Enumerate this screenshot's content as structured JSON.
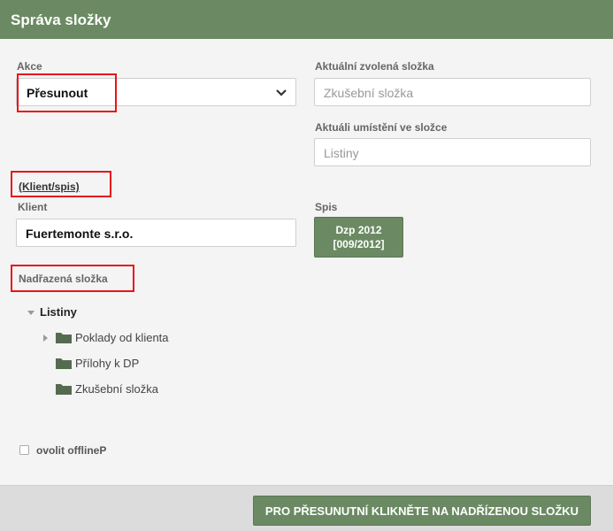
{
  "header": {
    "title": "Správa složky"
  },
  "akce": {
    "label": "Akce",
    "value": "Přesunout"
  },
  "current_folder": {
    "label": "Aktuální zvolená složka",
    "placeholder": "Zkušební složka"
  },
  "current_location": {
    "label": "Aktuáli umístění ve složce",
    "placeholder": "Listiny"
  },
  "client_spis_link": "(Klient/spis)",
  "client": {
    "label": "Klient",
    "value": "Fuertemonte s.r.o."
  },
  "spis": {
    "label": "Spis",
    "button_line1": "Dzp 2012",
    "button_line2": "[009/2012]"
  },
  "parent_folder": {
    "label": "Nadřazená složka"
  },
  "tree": {
    "root": "Listiny",
    "items": [
      "Poklady od klienta",
      "Přílohy k DP",
      "Zkušební složka"
    ]
  },
  "offline": {
    "label": "ovolit offlineP"
  },
  "submit_label": "PRO PŘESUNUTNÍ KLIKNĚTE NA NADŘÍZENOU SLOŽKU",
  "colors": {
    "accent": "#6b8a63",
    "highlight": "#e8141a",
    "folder": "#556b4f"
  }
}
